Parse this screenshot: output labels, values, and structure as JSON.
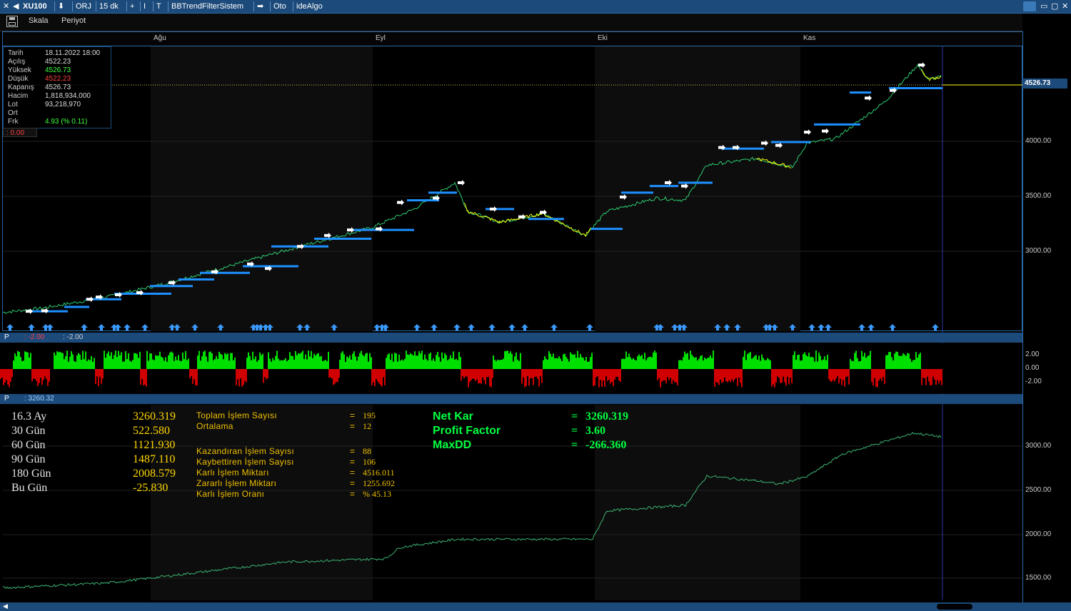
{
  "topbar": {
    "symbol": "XU100",
    "items": [
      "ORJ",
      "15 dk",
      "+",
      "I",
      "T",
      "BBTrendFilterSistem",
      "Oto",
      "ideAlgo"
    ]
  },
  "toolbar": {
    "scale": "Skala",
    "period": "Periyot"
  },
  "months": [
    "Ağu",
    "Eyl",
    "Eki",
    "Kas"
  ],
  "price_axis": [
    "4526.73",
    "4000.00",
    "3500.00",
    "3000.00"
  ],
  "indicator_axis": [
    "2.00",
    "0.00",
    "-2.00"
  ],
  "equity_axis": [
    "3000.00",
    "2500.00",
    "2000.00",
    "1500.00"
  ],
  "info": {
    "rows": [
      {
        "k": "Tarih",
        "v": "18.11.2022 18:00"
      },
      {
        "k": "Açılış",
        "v": "4522.23"
      },
      {
        "k": "Yüksek",
        "v": "4526.73"
      },
      {
        "k": "Düşük",
        "v": "4522.23"
      },
      {
        "k": "Kapanış",
        "v": "4526.73"
      },
      {
        "k": "Hacim",
        "v": "1,818,934,000"
      },
      {
        "k": "Lot",
        "v": "93,218,970"
      },
      {
        "k": "Ort",
        "v": ""
      },
      {
        "k": "Frk",
        "v": "4.93 (% 0.11)"
      }
    ],
    "delta": ": 0.00"
  },
  "panel2": {
    "p": "P",
    "v1": ": -2.00",
    "v2": ": -2.00"
  },
  "panel3": {
    "p": "P",
    "v1": ": 3260.32"
  },
  "stats": {
    "periods": [
      {
        "k": "16.3 Ay",
        "v": "3260.319"
      },
      {
        "k": "30 Gün",
        "v": "522.580"
      },
      {
        "k": "60 Gün",
        "v": "1121.930"
      },
      {
        "k": "90 Gün",
        "v": "1487.110"
      },
      {
        "k": "180 Gün",
        "v": "2008.579"
      },
      {
        "k": "Bu Gün",
        "v": "-25.830"
      }
    ],
    "middle": [
      {
        "k": "Toplam İşlem Sayısı",
        "v": "195"
      },
      {
        "k": "Ortalama",
        "v": "12"
      },
      {
        "k": "Kazandıran İşlem Sayısı",
        "v": "88"
      },
      {
        "k": "Kaybettiren İşlem Sayısı",
        "v": "106"
      },
      {
        "k": "Karlı İşlem Miktarı",
        "v": "4516.011"
      },
      {
        "k": "Zararlı İşlem Miktarı",
        "v": "1255.692"
      },
      {
        "k": "Karlı İşlem Oranı",
        "v": "% 45.13"
      }
    ],
    "eq": "=",
    "summary": [
      {
        "k": "Net Kar",
        "v": "3260.319"
      },
      {
        "k": "Profit Factor",
        "v": "3.60"
      },
      {
        "k": "MaxDD",
        "v": "-266.360"
      }
    ]
  },
  "colors": {
    "accent": "#1c4a7a",
    "price_up": "#2ecc71",
    "price_down": "#ffff00",
    "level_line": "#1e90ff",
    "indicator_pos": "#00e000",
    "indicator_neg": "#d00000",
    "equity": "#3cb371"
  },
  "chart_data": [
    {
      "type": "line",
      "x": [
        "Ağu",
        "Eyl",
        "Eki",
        "Kas"
      ],
      "series": [
        {
          "values": [
            2380,
            3150,
            3250,
            4526.73
          ]
        }
      ],
      "ylim": [
        2300,
        4800
      ]
    },
    {
      "type": "line",
      "series": [
        {
          "values": [
            1400,
            1500,
            1800,
            2250,
            2100,
            2550,
            2750,
            3050,
            3300,
            3260.32
          ]
        }
      ],
      "ylim": [
        1300,
        3500
      ]
    }
  ]
}
